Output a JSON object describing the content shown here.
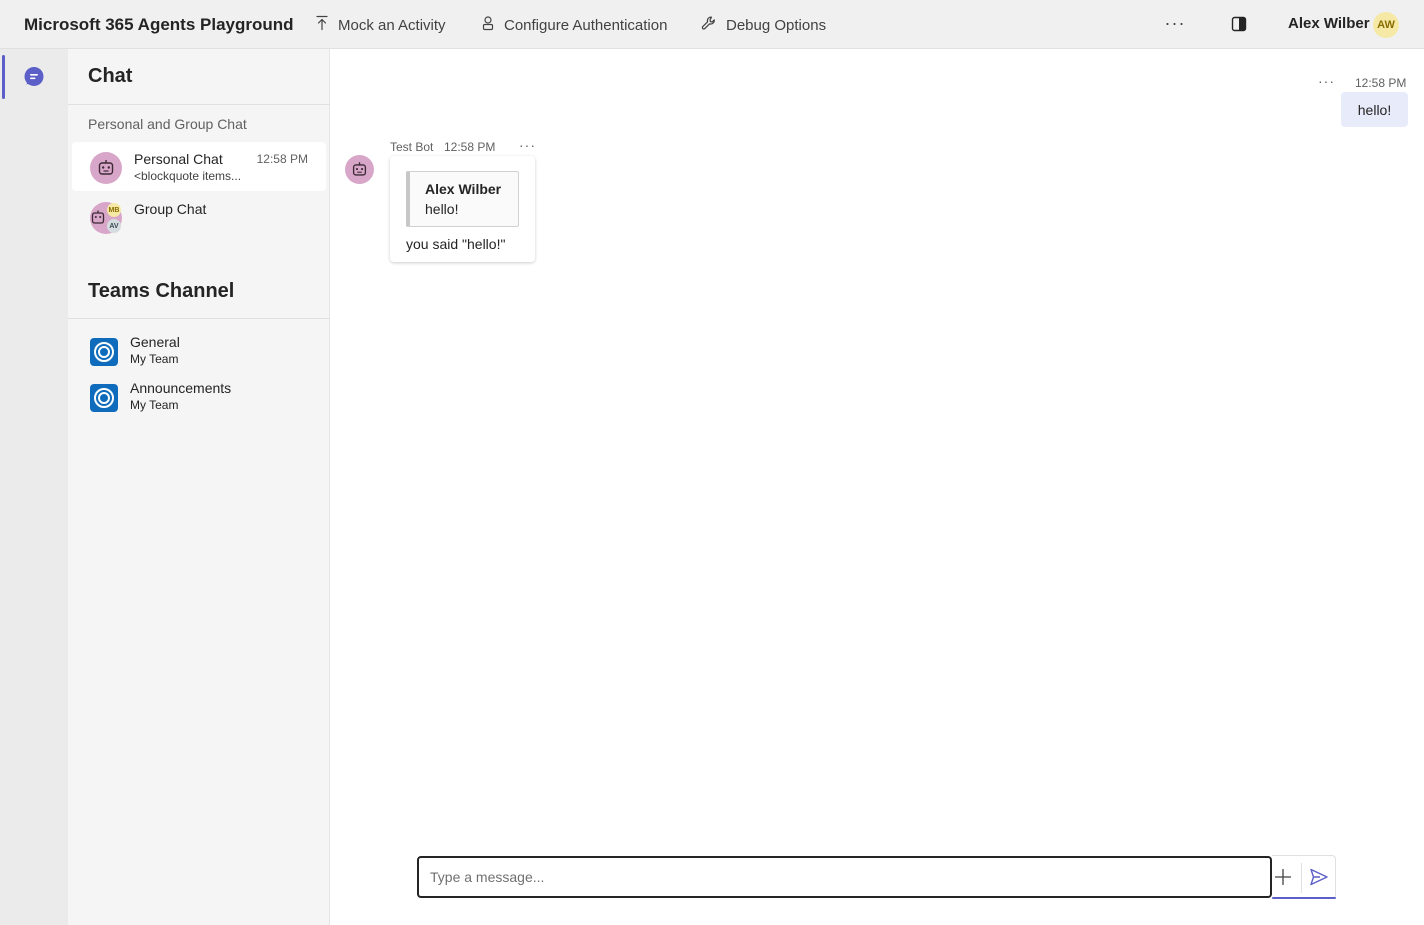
{
  "app": {
    "title": "Microsoft 365 Agents Playground"
  },
  "toolbar": {
    "mock_activity": "Mock an Activity",
    "configure_auth": "Configure Authentication",
    "debug_options": "Debug Options",
    "more": "···",
    "user_name": "Alex Wilber",
    "user_initials": "AW"
  },
  "sidebar": {
    "chat_heading": "Chat",
    "section_label": "Personal and Group Chat",
    "chats": [
      {
        "title": "Personal Chat",
        "preview": "<blockquote items...",
        "time": "12:58 PM"
      },
      {
        "title": "Group Chat",
        "avatar_initials": [
          "MB",
          "AV"
        ]
      }
    ],
    "channels_heading": "Teams Channel",
    "channels": [
      {
        "title": "General",
        "team": "My Team"
      },
      {
        "title": "Announcements",
        "team": "My Team"
      }
    ]
  },
  "conversation": {
    "user_message": {
      "time": "12:58 PM",
      "text": "hello!",
      "more": "···"
    },
    "bot_message": {
      "sender": "Test Bot",
      "time": "12:58 PM",
      "more": "···",
      "quote_author": "Alex Wilber",
      "quote_text": "hello!",
      "text": "you said \"hello!\""
    }
  },
  "composer": {
    "placeholder": "Type a message..."
  },
  "colors": {
    "accent": "#5b5fc7",
    "bot_avatar": "#d7a6c8",
    "user_avatar": "#f6e9a6",
    "channel_icon": "#0f6cbd",
    "user_bubble": "#e8ebfa"
  },
  "icons": [
    "upload-icon",
    "person-lock-icon",
    "wrench-icon",
    "more-icon",
    "side-panel-icon",
    "chat-icon",
    "bot-icon",
    "channel-icon",
    "add-icon",
    "send-icon"
  ]
}
